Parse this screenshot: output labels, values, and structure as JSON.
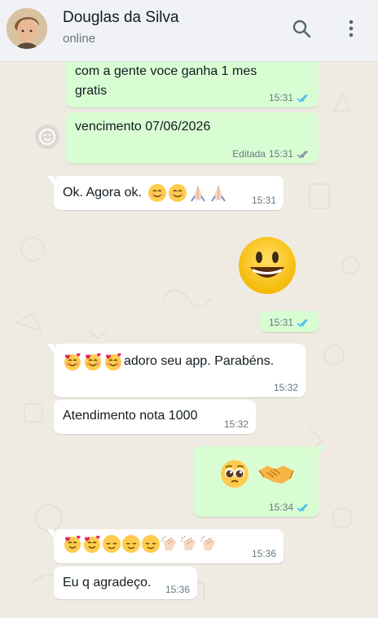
{
  "header": {
    "name": "Douglas da Silva",
    "status": "online"
  },
  "colors": {
    "outgoing": "#d9fdd3",
    "incoming": "#ffffff",
    "read_tick": "#53bdeb",
    "sent_tick": "#8696a0",
    "background": "#efeae2"
  },
  "messages": [
    {
      "direction": "out",
      "text": "com a gente voce ganha 1 mes gratis",
      "line1": "com a gente voce ganha 1 mes",
      "line2": "gratis",
      "time": "15:31",
      "status": "read"
    },
    {
      "direction": "out",
      "text": "vencimento 07/06/2026",
      "edited": "Editada",
      "time": "15:31",
      "status": "delivered"
    },
    {
      "direction": "in",
      "text": "Ok. Agora ok.",
      "emojis": [
        "smiling-face-icon",
        "smiling-face-icon",
        "folded-hands-icon",
        "folded-hands-icon"
      ],
      "time": "15:31"
    },
    {
      "direction": "out",
      "emojis": [
        "grinning-face-icon"
      ],
      "time": "15:31",
      "status": "read"
    },
    {
      "direction": "in",
      "text": "adoro seu app. Parabéns.",
      "emojis": [
        "smiling-face-hearts-icon",
        "smiling-face-hearts-icon",
        "smiling-face-hearts-icon"
      ],
      "time": "15:32"
    },
    {
      "direction": "in",
      "text": "Atendimento nota 1000",
      "time": "15:32"
    },
    {
      "direction": "out",
      "emojis": [
        "pleading-face-icon",
        "handshake-icon"
      ],
      "time": "15:34",
      "status": "read"
    },
    {
      "direction": "in",
      "emojis": [
        "smiling-face-hearts-icon",
        "smiling-face-hearts-icon",
        "relieved-face-icon",
        "relieved-face-icon",
        "relieved-face-icon",
        "clapping-hands-icon",
        "clapping-hands-icon",
        "clapping-hands-icon"
      ],
      "time": "15:36"
    },
    {
      "direction": "in",
      "text": "Eu q agradeço.",
      "time": "15:36"
    }
  ]
}
